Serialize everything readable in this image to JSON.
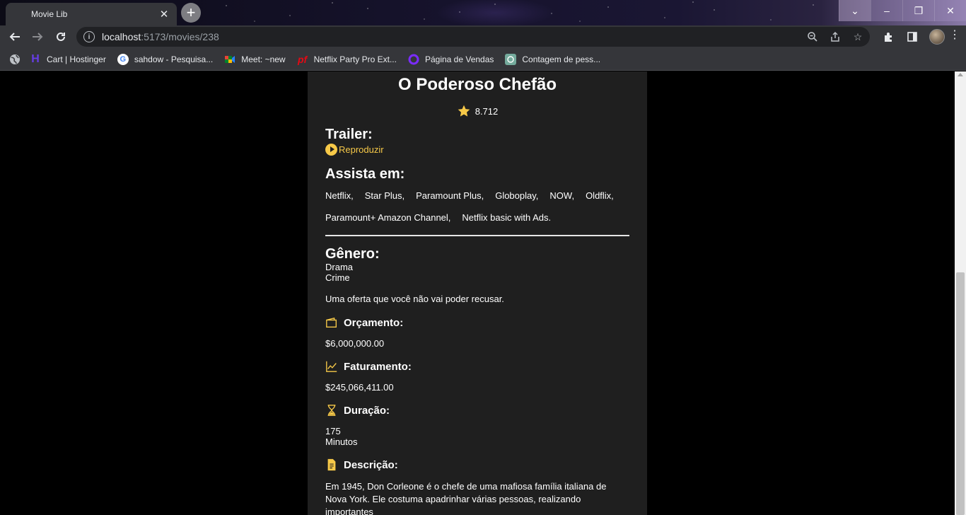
{
  "browser": {
    "tab_title": "Movie Lib",
    "url_host": "localhost",
    "url_path": ":5173/movies/238",
    "bookmarks": [
      {
        "label": "Cart | Hostinger",
        "icon": "hostinger-icon",
        "color": "#673de6"
      },
      {
        "label": "sahdow - Pesquisa...",
        "icon": "google-icon",
        "color": "#ffffff"
      },
      {
        "label": "Meet: ~new",
        "icon": "meet-icon",
        "color": "#00832d"
      },
      {
        "label": "Netflix Party Pro Ext...",
        "icon": "netflix-party-icon",
        "color": "#e50914"
      },
      {
        "label": "Página de Vendas",
        "icon": "sales-page-icon",
        "color": "#7b2cff"
      },
      {
        "label": "Contagem de pess...",
        "icon": "chatgpt-icon",
        "color": "#74aa9c"
      }
    ]
  },
  "movie": {
    "title": "O Poderoso Chefão",
    "rating": "8.712",
    "trailer_heading": "Trailer:",
    "trailer_link": "Reproduzir",
    "watch_heading": "Assista em:",
    "providers": [
      "Netflix,",
      "Star Plus,",
      "Paramount Plus,",
      "Globoplay,",
      "NOW,",
      "Oldflix,",
      "Paramount+ Amazon Channel,",
      "Netflix basic with Ads."
    ],
    "genre_heading": "Gênero:",
    "genres": [
      "Drama",
      "Crime"
    ],
    "tagline": "Uma oferta que você não vai poder recusar.",
    "budget_heading": "Orçamento:",
    "budget": "$6,000,000.00",
    "revenue_heading": "Faturamento:",
    "revenue": "$245,066,411.00",
    "runtime_heading": "Duração:",
    "runtime": "175",
    "runtime_unit": "Minutos",
    "description_heading": "Descrição:",
    "description": "Em 1945, Don Corleone é o chefe de uma mafiosa família italiana de Nova York. Ele costuma apadrinhar várias pessoas, realizando importantes",
    "accent_color": "#f7c948"
  }
}
